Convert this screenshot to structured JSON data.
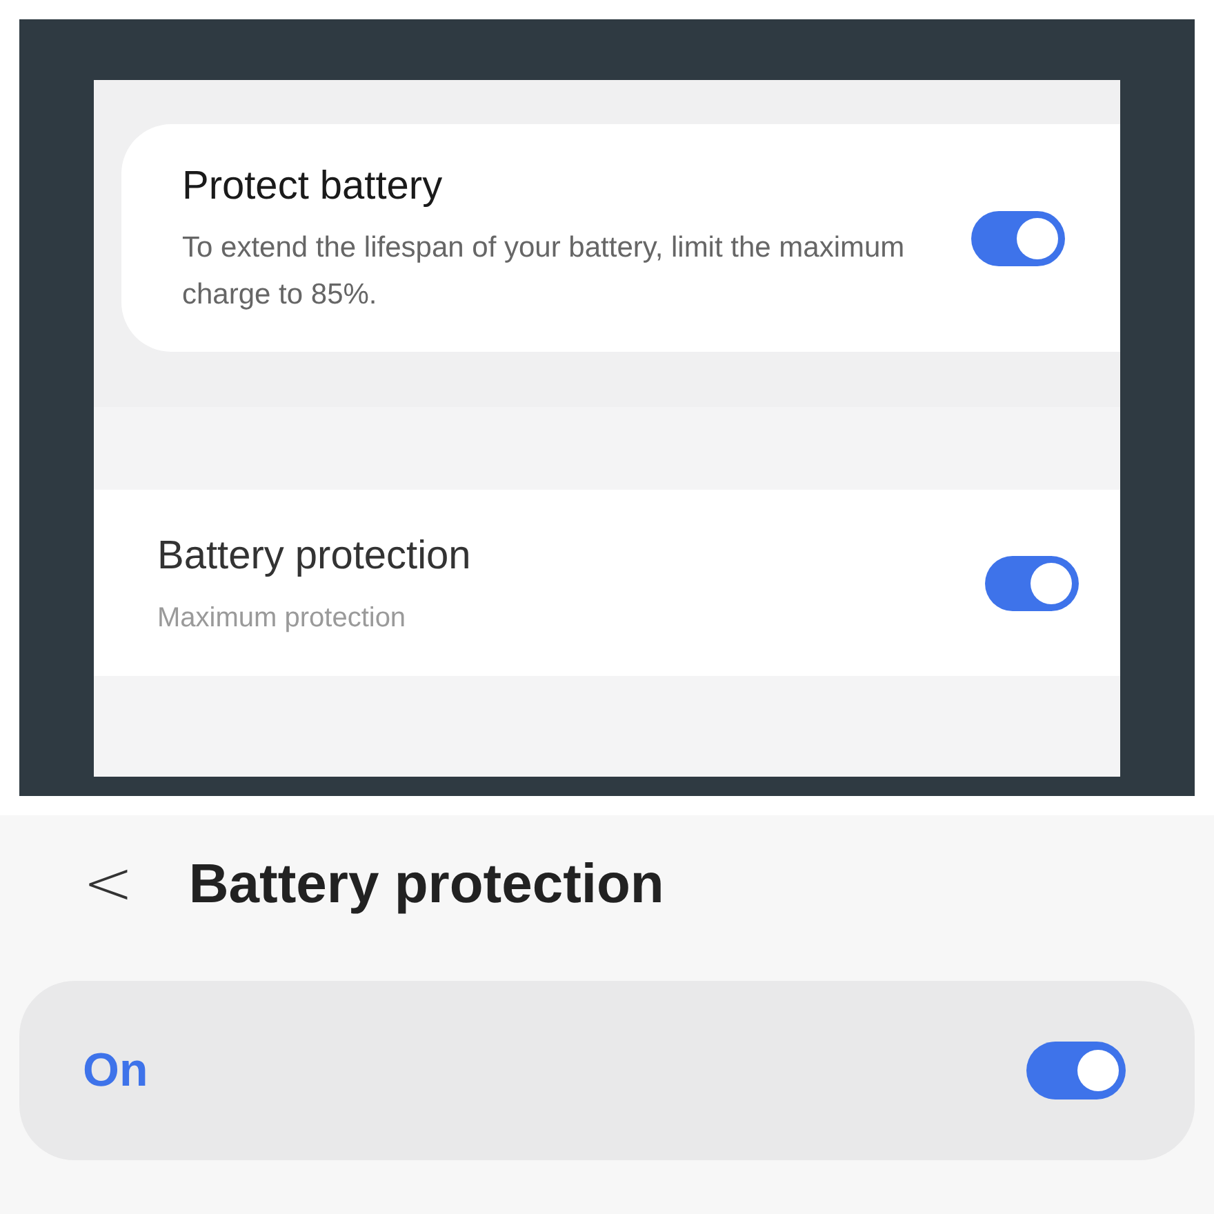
{
  "top_screenshot": {
    "protect_setting": {
      "title": "Protect battery",
      "description": "To extend the lifespan of your battery, limit the maximum charge to 85%.",
      "on": true
    },
    "protection_setting": {
      "title": "Battery protection",
      "subtitle": "Maximum protection",
      "on": true
    }
  },
  "bottom_screenshot": {
    "header": {
      "back": "<",
      "title": "Battery protection"
    },
    "master_switch": {
      "label": "On",
      "on": true
    }
  }
}
